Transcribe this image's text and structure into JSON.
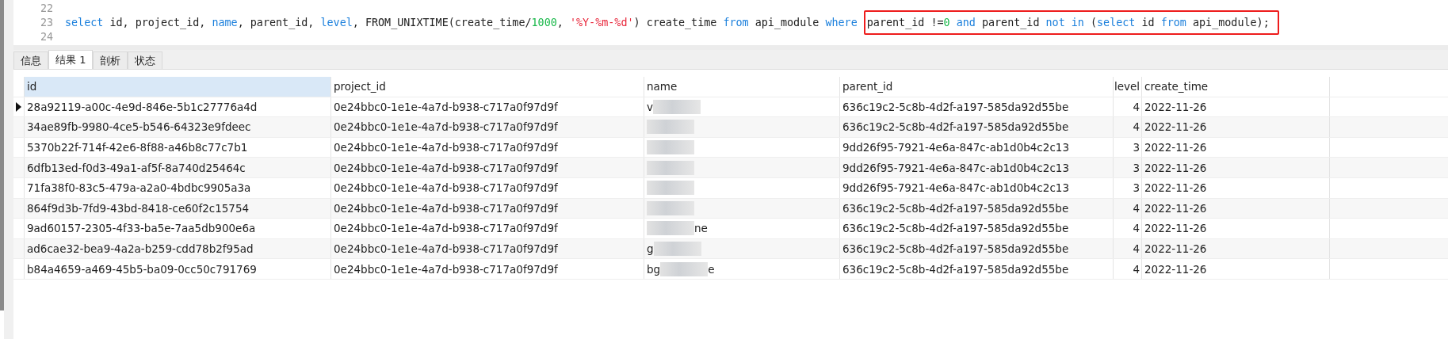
{
  "editor": {
    "lines": [
      {
        "number": "22"
      },
      {
        "number": "23",
        "tokens": [
          {
            "kind": "keyword",
            "text": "select"
          },
          {
            "kind": "plain",
            "text": " id, project_id, "
          },
          {
            "kind": "keyword",
            "text": "name"
          },
          {
            "kind": "plain",
            "text": ", parent_id, "
          },
          {
            "kind": "keyword",
            "text": "level"
          },
          {
            "kind": "plain",
            "text": ", FROM_UNIXTIME(create_time/"
          },
          {
            "kind": "number",
            "text": "1000"
          },
          {
            "kind": "plain",
            "text": ", "
          },
          {
            "kind": "string",
            "text": "'%Y-%m-%d'"
          },
          {
            "kind": "plain",
            "text": ") create_time "
          },
          {
            "kind": "keyword",
            "text": "from"
          },
          {
            "kind": "plain",
            "text": " api_module "
          },
          {
            "kind": "keyword",
            "text": "where"
          }
        ],
        "boxed_tokens": [
          {
            "kind": "plain",
            "text": "parent_id !="
          },
          {
            "kind": "number",
            "text": "0"
          },
          {
            "kind": "keyword",
            "text": " and"
          },
          {
            "kind": "plain",
            "text": " parent_id "
          },
          {
            "kind": "keyword",
            "text": "not in"
          },
          {
            "kind": "plain",
            "text": " ("
          },
          {
            "kind": "keyword",
            "text": "select"
          },
          {
            "kind": "plain",
            "text": " id "
          },
          {
            "kind": "keyword",
            "text": "from"
          },
          {
            "kind": "plain",
            "text": " api_module);"
          }
        ]
      },
      {
        "number": "24"
      }
    ]
  },
  "tabs": [
    {
      "label": "信息",
      "selected": false
    },
    {
      "label": "结果 1",
      "selected": true
    },
    {
      "label": "剖析",
      "selected": false
    },
    {
      "label": "状态",
      "selected": false
    }
  ],
  "table": {
    "columns": [
      {
        "label": "id",
        "selected": true
      },
      {
        "label": "project_id",
        "selected": false
      },
      {
        "label": "name",
        "selected": false
      },
      {
        "label": "parent_id",
        "selected": false
      },
      {
        "label": "level",
        "selected": false
      },
      {
        "label": "create_time",
        "selected": false
      }
    ],
    "rows": [
      {
        "current": true,
        "id": "28a92119-a00c-4e9d-846e-5b1c27776a4d",
        "project_id": "0e24bbc0-1e1e-4a7d-b938-c717a0f97d9f",
        "name": {
          "before": "v"
        },
        "parent_id": "636c19c2-5c8b-4d2f-a197-585da92d55be",
        "level": "4",
        "create_time": "2022-11-26"
      },
      {
        "current": false,
        "id": "34ae89fb-9980-4ce5-b546-64323e9fdeec",
        "project_id": "0e24bbc0-1e1e-4a7d-b938-c717a0f97d9f",
        "name": {},
        "parent_id": "636c19c2-5c8b-4d2f-a197-585da92d55be",
        "level": "4",
        "create_time": "2022-11-26"
      },
      {
        "current": false,
        "id": "5370b22f-714f-42e6-8f88-a46b8c77c7b1",
        "project_id": "0e24bbc0-1e1e-4a7d-b938-c717a0f97d9f",
        "name": {},
        "parent_id": "9dd26f95-7921-4e6a-847c-ab1d0b4c2c13",
        "level": "3",
        "create_time": "2022-11-26"
      },
      {
        "current": false,
        "id": "6dfb13ed-f0d3-49a1-af5f-8a740d25464c",
        "project_id": "0e24bbc0-1e1e-4a7d-b938-c717a0f97d9f",
        "name": {},
        "parent_id": "9dd26f95-7921-4e6a-847c-ab1d0b4c2c13",
        "level": "3",
        "create_time": "2022-11-26"
      },
      {
        "current": false,
        "id": "71fa38f0-83c5-479a-a2a0-4bdbc9905a3a",
        "project_id": "0e24bbc0-1e1e-4a7d-b938-c717a0f97d9f",
        "name": {},
        "parent_id": "9dd26f95-7921-4e6a-847c-ab1d0b4c2c13",
        "level": "3",
        "create_time": "2022-11-26"
      },
      {
        "current": false,
        "id": "864f9d3b-7fd9-43bd-8418-ce60f2c15754",
        "project_id": "0e24bbc0-1e1e-4a7d-b938-c717a0f97d9f",
        "name": {},
        "parent_id": "636c19c2-5c8b-4d2f-a197-585da92d55be",
        "level": "4",
        "create_time": "2022-11-26"
      },
      {
        "current": false,
        "id": "9ad60157-2305-4f33-ba5e-7aa5db900e6a",
        "project_id": "0e24bbc0-1e1e-4a7d-b938-c717a0f97d9f",
        "name": {
          "after": "ne"
        },
        "parent_id": "636c19c2-5c8b-4d2f-a197-585da92d55be",
        "level": "4",
        "create_time": "2022-11-26"
      },
      {
        "current": false,
        "id": "ad6cae32-bea9-4a2a-b259-cdd78b2f95ad",
        "project_id": "0e24bbc0-1e1e-4a7d-b938-c717a0f97d9f",
        "name": {
          "before": "g"
        },
        "parent_id": "636c19c2-5c8b-4d2f-a197-585da92d55be",
        "level": "4",
        "create_time": "2022-11-26"
      },
      {
        "current": false,
        "id": "b84a4659-a469-45b5-ba09-0cc50c791769",
        "project_id": "0e24bbc0-1e1e-4a7d-b938-c717a0f97d9f",
        "name": {
          "before": "bg",
          "after": "e"
        },
        "parent_id": "636c19c2-5c8b-4d2f-a197-585da92d55be",
        "level": "4",
        "create_time": "2022-11-26"
      }
    ]
  }
}
